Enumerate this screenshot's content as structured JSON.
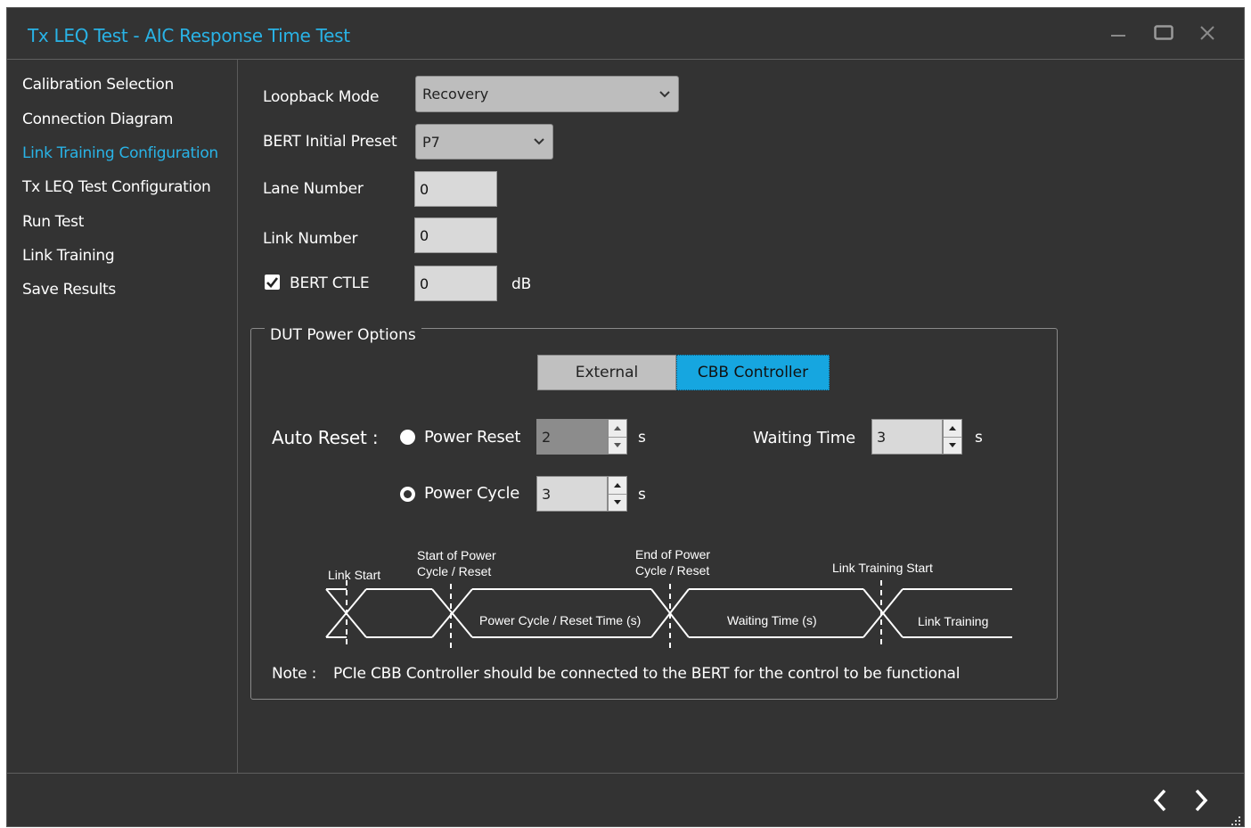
{
  "window": {
    "title": "Tx LEQ Test - AIC Response Time Test"
  },
  "sidebar": {
    "items": [
      {
        "label": "Calibration Selection"
      },
      {
        "label": "Connection Diagram"
      },
      {
        "label": "Link Training Configuration",
        "active": true
      },
      {
        "label": "Tx LEQ Test Configuration"
      },
      {
        "label": "Run Test"
      },
      {
        "label": "Link Training"
      },
      {
        "label": "Save Results"
      }
    ]
  },
  "form": {
    "loopback_mode": {
      "label": "Loopback Mode",
      "value": "Recovery"
    },
    "bert_initial_preset": {
      "label": "BERT Initial Preset",
      "value": "P7"
    },
    "lane_number": {
      "label": "Lane Number",
      "value": "0"
    },
    "link_number": {
      "label": "Link Number",
      "value": "0"
    },
    "bert_ctle": {
      "label": "BERT CTLE",
      "checked": true,
      "value": "0",
      "unit": "dB"
    }
  },
  "dut_power": {
    "legend": "DUT Power Options",
    "toggle": {
      "external": "External",
      "cbb": "CBB Controller",
      "selected": "CBB Controller"
    },
    "auto_reset_label": "Auto Reset :",
    "power_reset": {
      "label": "Power Reset",
      "value": "2",
      "unit": "s",
      "selected": false
    },
    "power_cycle": {
      "label": "Power Cycle",
      "value": "3",
      "unit": "s",
      "selected": true
    },
    "waiting_time": {
      "label": "Waiting Time",
      "value": "3",
      "unit": "s"
    },
    "diagram": {
      "link_start": "Link Start",
      "start_power_1": "Start of Power",
      "start_power_2": "Cycle / Reset",
      "end_power_1": "End of Power",
      "end_power_2": "Cycle / Reset",
      "link_training_start": "Link Training Start",
      "seg_power": "Power Cycle / Reset Time (s)",
      "seg_waiting": "Waiting Time (s)",
      "seg_link": "Link Training"
    },
    "note_label": "Note :",
    "note_text": "PCIe CBB Controller should be connected to the BERT for the control to be functional"
  },
  "colors": {
    "accent": "#29b3e6",
    "background": "#333333",
    "toggle_selected": "#16a6e0",
    "toggle_unselected": "#c0c0c0"
  }
}
